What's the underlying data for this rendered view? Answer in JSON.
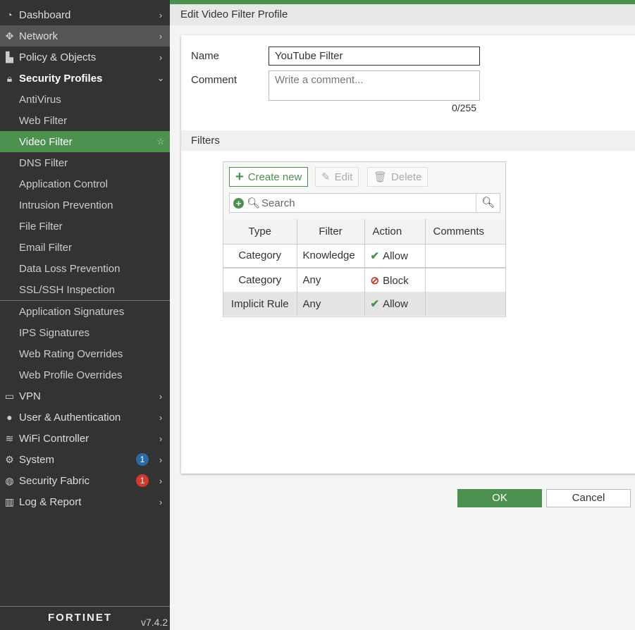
{
  "sidebar": {
    "items": [
      {
        "label": "Dashboard",
        "icon": "dashboard-icon"
      },
      {
        "label": "Network",
        "icon": "network-icon"
      },
      {
        "label": "Policy & Objects",
        "icon": "policy-icon"
      },
      {
        "label": "Security Profiles",
        "icon": "lock-icon"
      },
      {
        "label": "AntiVirus"
      },
      {
        "label": "Web Filter"
      },
      {
        "label": "Video Filter"
      },
      {
        "label": "DNS Filter"
      },
      {
        "label": "Application Control"
      },
      {
        "label": "Intrusion Prevention"
      },
      {
        "label": "File Filter"
      },
      {
        "label": "Email Filter"
      },
      {
        "label": "Data Loss Prevention"
      },
      {
        "label": "SSL/SSH Inspection"
      },
      {
        "label": "Application Signatures"
      },
      {
        "label": "IPS Signatures"
      },
      {
        "label": "Web Rating Overrides"
      },
      {
        "label": "Web Profile Overrides"
      },
      {
        "label": "VPN",
        "icon": "laptop-icon"
      },
      {
        "label": "User & Authentication",
        "icon": "user-icon"
      },
      {
        "label": "WiFi Controller",
        "icon": "wifi-icon"
      },
      {
        "label": "System",
        "icon": "gear-icon",
        "badge": "1",
        "badge_color": "#2a6aa8"
      },
      {
        "label": "Security Fabric",
        "icon": "fabric-icon",
        "badge": "1",
        "badge_color": "#d0392b"
      },
      {
        "label": "Log & Report",
        "icon": "chart-icon"
      }
    ],
    "logo": "FORTINET",
    "version": "v7.4.2"
  },
  "header": {
    "title": "Edit Video Filter Profile"
  },
  "form": {
    "name_label": "Name",
    "name_value": "YouTube Filter",
    "comment_label": "Comment",
    "comment_placeholder": "Write a comment...",
    "comment_count": "0/255"
  },
  "filters": {
    "title": "Filters",
    "create_label": "Create new",
    "edit_label": "Edit",
    "delete_label": "Delete",
    "search_placeholder": "Search",
    "columns": [
      "Type",
      "Filter",
      "Action",
      "Comments"
    ],
    "rows": [
      {
        "type": "Category",
        "filter": "Knowledge",
        "action": "Allow",
        "comments": ""
      },
      {
        "type": "Category",
        "filter": "Any",
        "action": "Block",
        "comments": ""
      },
      {
        "type": "Implicit Rule",
        "filter": "Any",
        "action": "Allow",
        "comments": ""
      }
    ]
  },
  "buttons": {
    "ok": "OK",
    "cancel": "Cancel"
  },
  "colors": {
    "accent": "#4c9150",
    "sidebar": "#333333"
  }
}
